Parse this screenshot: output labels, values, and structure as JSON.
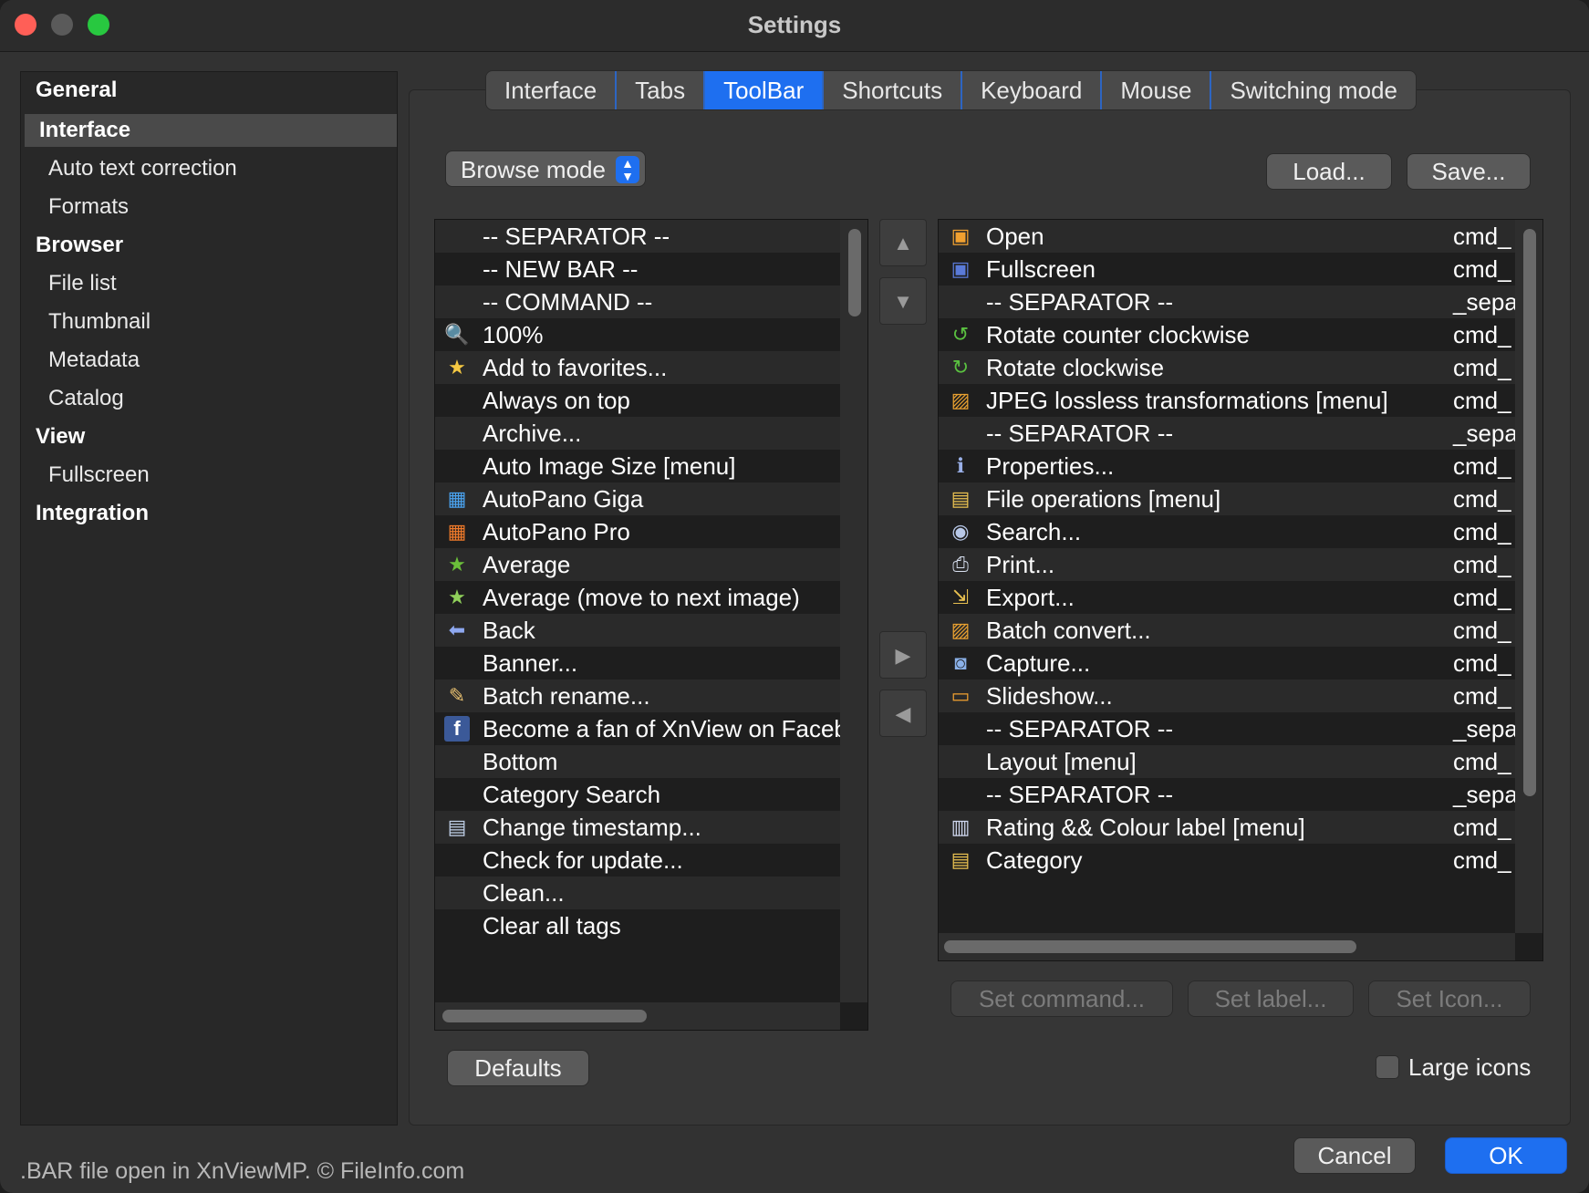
{
  "window": {
    "title": "Settings"
  },
  "sidebar": {
    "items": [
      {
        "label": "General"
      },
      {
        "label": "Interface"
      },
      {
        "label": "Auto text correction"
      },
      {
        "label": "Formats"
      },
      {
        "label": "Browser"
      },
      {
        "label": "File list"
      },
      {
        "label": "Thumbnail"
      },
      {
        "label": "Metadata"
      },
      {
        "label": "Catalog"
      },
      {
        "label": "View"
      },
      {
        "label": "Fullscreen"
      },
      {
        "label": "Integration"
      }
    ]
  },
  "tabs": [
    {
      "label": "Interface"
    },
    {
      "label": "Tabs"
    },
    {
      "label": "ToolBar"
    },
    {
      "label": "Shortcuts"
    },
    {
      "label": "Keyboard"
    },
    {
      "label": "Mouse"
    },
    {
      "label": "Switching mode"
    }
  ],
  "toolbar_tab": {
    "mode_select": {
      "value": "Browse mode"
    },
    "load_label": "Load...",
    "save_label": "Save...",
    "available_list": [
      {
        "label": "-- SEPARATOR --",
        "icon": ""
      },
      {
        "label": "-- NEW BAR --",
        "icon": ""
      },
      {
        "label": "-- COMMAND --",
        "icon": ""
      },
      {
        "label": "100%",
        "icon": "magnifier-icon"
      },
      {
        "label": "Add to favorites...",
        "icon": "star-icon"
      },
      {
        "label": "Always on top",
        "icon": ""
      },
      {
        "label": "Archive...",
        "icon": ""
      },
      {
        "label": "Auto Image Size [menu]",
        "icon": ""
      },
      {
        "label": "AutoPano Giga",
        "icon": "apg-icon"
      },
      {
        "label": "AutoPano Pro",
        "icon": "app-icon"
      },
      {
        "label": "Average",
        "icon": "average-star-icon"
      },
      {
        "label": "Average (move to next image)",
        "icon": "average-next-icon"
      },
      {
        "label": "Back",
        "icon": "back-arrow-icon"
      },
      {
        "label": "Banner...",
        "icon": ""
      },
      {
        "label": "Batch rename...",
        "icon": "batch-rename-icon"
      },
      {
        "label": "Become a fan of XnView on Facebook",
        "icon": "facebook-icon"
      },
      {
        "label": "Bottom",
        "icon": ""
      },
      {
        "label": "Category Search",
        "icon": ""
      },
      {
        "label": "Change timestamp...",
        "icon": "calendar-icon"
      },
      {
        "label": "Check for update...",
        "icon": ""
      },
      {
        "label": "Clean...",
        "icon": ""
      },
      {
        "label": "Clear all tags",
        "icon": ""
      }
    ],
    "current_list": [
      {
        "label": "Open",
        "cmd": "cmd_",
        "icon": "open-folder-icon"
      },
      {
        "label": "Fullscreen",
        "cmd": "cmd_",
        "icon": "fullscreen-icon"
      },
      {
        "label": "-- SEPARATOR --",
        "cmd": "_sepa",
        "icon": ""
      },
      {
        "label": "Rotate counter clockwise",
        "cmd": "cmd_",
        "icon": "rotate-ccw-icon"
      },
      {
        "label": "Rotate clockwise",
        "cmd": "cmd_",
        "icon": "rotate-cw-icon"
      },
      {
        "label": "JPEG lossless transformations [menu]",
        "cmd": "cmd_",
        "icon": "jpeg-transform-icon"
      },
      {
        "label": "-- SEPARATOR --",
        "cmd": "_sepa",
        "icon": ""
      },
      {
        "label": "Properties...",
        "cmd": "cmd_",
        "icon": "properties-icon"
      },
      {
        "label": "File operations [menu]",
        "cmd": "cmd_",
        "icon": "file-operations-icon"
      },
      {
        "label": "Search...",
        "cmd": "cmd_",
        "icon": "binoculars-icon"
      },
      {
        "label": "Print...",
        "cmd": "cmd_",
        "icon": "printer-icon"
      },
      {
        "label": "Export...",
        "cmd": "cmd_",
        "icon": "export-icon"
      },
      {
        "label": "Batch convert...",
        "cmd": "cmd_",
        "icon": "batch-convert-icon"
      },
      {
        "label": "Capture...",
        "cmd": "cmd_",
        "icon": "camera-icon"
      },
      {
        "label": "Slideshow...",
        "cmd": "cmd_",
        "icon": "slideshow-icon"
      },
      {
        "label": "-- SEPARATOR --",
        "cmd": "_sepa",
        "icon": ""
      },
      {
        "label": "Layout [menu]",
        "cmd": "cmd_",
        "icon": ""
      },
      {
        "label": "-- SEPARATOR --",
        "cmd": "_sepa",
        "icon": ""
      },
      {
        "label": "Rating && Colour label [menu]",
        "cmd": "cmd_",
        "icon": "rating-icon"
      },
      {
        "label": "Category",
        "cmd": "cmd_",
        "icon": "category-icon"
      }
    ],
    "set_command_label": "Set command...",
    "set_label_label": "Set label...",
    "set_icon_label": "Set Icon...",
    "defaults_label": "Defaults",
    "large_icons_label": "Large icons",
    "large_icons_checked": false
  },
  "dialog": {
    "cancel_label": "Cancel",
    "ok_label": "OK"
  },
  "footer": {
    "text": ".BAR file open in XnViewMP. © FileInfo.com"
  },
  "colors": {
    "accent": "#1e6ff0",
    "background": "#323232",
    "list_bg": "#1e1e1e",
    "row_alt": "#2a2a2a"
  }
}
